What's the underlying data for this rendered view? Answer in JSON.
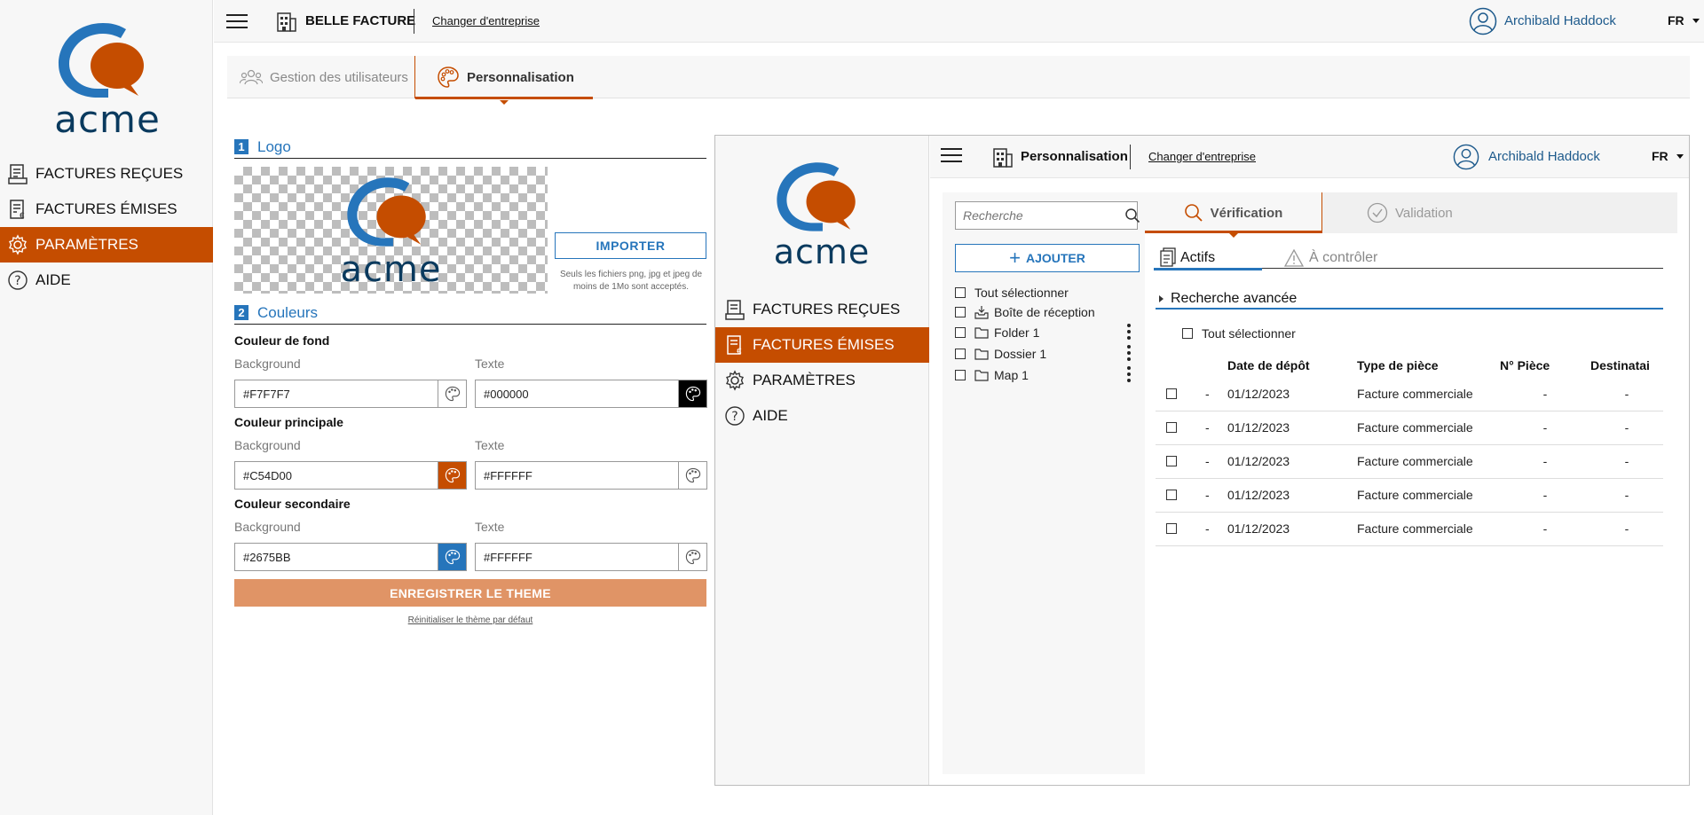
{
  "brand": {
    "logo_text": "acme",
    "colors": {
      "primary": "#C54D00",
      "secondary": "#2675BB",
      "logo_dark": "#0A3A5E",
      "background": "#F7F7F7"
    }
  },
  "sidebar": {
    "items": [
      {
        "label": "FACTURES REÇUES",
        "icon": "received-invoice-icon",
        "active": false
      },
      {
        "label": "FACTURES ÉMISES",
        "icon": "issued-invoice-icon",
        "active": false
      },
      {
        "label": "PARAMÈTRES",
        "icon": "gear-icon",
        "active": true
      },
      {
        "label": "AIDE",
        "icon": "help-icon",
        "active": false
      }
    ]
  },
  "topbar": {
    "company": "BELLE FACTURE",
    "change_company": "Changer d'entreprise",
    "user": "Archibald Haddock",
    "lang": "FR"
  },
  "tabs": [
    {
      "label": "Gestion des utilisateurs",
      "icon": "users-icon",
      "active": false
    },
    {
      "label": "Personnalisation",
      "icon": "palette-icon",
      "active": true
    }
  ],
  "form": {
    "logo_section": {
      "number": "1",
      "title": "Logo"
    },
    "import_label": "IMPORTER",
    "import_note": "Seuls les fichiers png, jpg et jpeg de moins de 1Mo sont acceptés.",
    "colors_section": {
      "number": "2",
      "title": "Couleurs"
    },
    "groups": [
      {
        "title": "Couleur de fond",
        "bg_label": "Background",
        "bg_value": "#F7F7F7",
        "bg_swatch": "#FFFFFF",
        "text_label": "Texte",
        "text_value": "#000000",
        "text_swatch": "#000000"
      },
      {
        "title": "Couleur principale",
        "bg_label": "Background",
        "bg_value": "#C54D00",
        "bg_swatch": "#C54D00",
        "text_label": "Texte",
        "text_value": "#FFFFFF",
        "text_swatch": "#FFFFFF"
      },
      {
        "title": "Couleur secondaire",
        "bg_label": "Background",
        "bg_value": "#2675BB",
        "bg_swatch": "#2675BB",
        "text_label": "Texte",
        "text_value": "#FFFFFF",
        "text_swatch": "#FFFFFF"
      }
    ],
    "save_label": "ENREGISTRER LE THEME",
    "reset_label": "Réinitialiser le thème par défaut"
  },
  "preview": {
    "sidebar_items": [
      {
        "label": "FACTURES REÇUES",
        "icon": "received-invoice-icon",
        "active": false
      },
      {
        "label": "FACTURES ÉMISES",
        "icon": "issued-invoice-icon",
        "active": true
      },
      {
        "label": "PARAMÈTRES",
        "icon": "gear-icon",
        "active": false
      },
      {
        "label": "AIDE",
        "icon": "help-icon",
        "active": false
      }
    ],
    "topbar": {
      "title": "Personnalisation",
      "change_company": "Changer d'entreprise",
      "user": "Archibald Haddock",
      "lang": "FR"
    },
    "search_placeholder": "Recherche",
    "add_label": "AJOUTER",
    "tree": {
      "select_all": "Tout sélectionner",
      "items": [
        {
          "label": "Boîte de réception",
          "icon": "inbox-icon",
          "menu": false
        },
        {
          "label": "Folder 1",
          "icon": "folder-icon",
          "menu": true
        },
        {
          "label": "Dossier 1",
          "icon": "folder-icon",
          "menu": true
        },
        {
          "label": "Map 1",
          "icon": "folder-icon",
          "menu": true
        }
      ]
    },
    "workflow_tabs": [
      {
        "label": "Vérification",
        "icon": "search-icon",
        "active": true
      },
      {
        "label": "Validation",
        "icon": "check-circle-icon",
        "active": false
      }
    ],
    "sub_tabs": [
      {
        "label": "Actifs",
        "icon": "document-icon",
        "active": true
      },
      {
        "label": "À contrôler",
        "icon": "warning-icon",
        "active": false
      }
    ],
    "advanced_search": "Recherche avancée",
    "select_all": "Tout sélectionner",
    "table": {
      "columns": [
        "",
        "",
        "Date de dépôt",
        "Type de pièce",
        "N° Pièce",
        "Destinatai"
      ],
      "rows": [
        [
          "-",
          "01/12/2023",
          "Facture commerciale",
          "-",
          "-"
        ],
        [
          "-",
          "01/12/2023",
          "Facture commerciale",
          "-",
          "-"
        ],
        [
          "-",
          "01/12/2023",
          "Facture commerciale",
          "-",
          "-"
        ],
        [
          "-",
          "01/12/2023",
          "Facture commerciale",
          "-",
          "-"
        ],
        [
          "-",
          "01/12/2023",
          "Facture commerciale",
          "-",
          "-"
        ]
      ]
    }
  }
}
